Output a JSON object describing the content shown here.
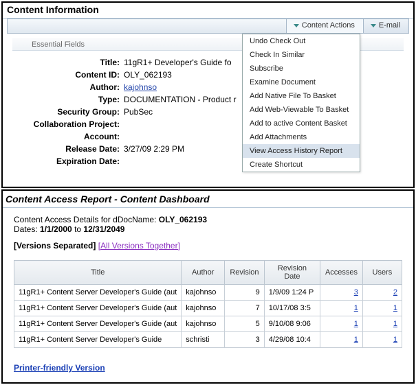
{
  "info": {
    "panel_title": "Content Information",
    "menus": {
      "content_actions": "Content Actions",
      "email": "E-mail"
    },
    "dropdown": [
      "Undo Check Out",
      "Check In Similar",
      "Subscribe",
      "Examine Document",
      "Add Native File To Basket",
      "Add Web-Viewable To Basket",
      "Add to active Content Basket",
      "Add Attachments",
      "View Access History Report",
      "Create Shortcut"
    ],
    "dropdown_highlight_index": 8,
    "fieldset": "Essential Fields",
    "labels": {
      "title": "Title:",
      "content_id": "Content ID:",
      "author": "Author:",
      "type": "Type:",
      "security_group": "Security Group:",
      "collab": "Collaboration Project:",
      "account": "Account:",
      "release_date": "Release Date:",
      "expiration_date": "Expiration Date:"
    },
    "values": {
      "title": "11gR1+ Developer's Guide fo",
      "content_id": "OLY_062193",
      "author": "kajohnso",
      "type": "DOCUMENTATION - Product r",
      "security_group": "PubSec",
      "collab": "",
      "account": "",
      "release_date": "3/27/09 2:29 PM",
      "expiration_date": ""
    }
  },
  "report": {
    "panel_title": "Content Access Report - Content Dashboard",
    "meta_prefix": "Content Access Details for dDocName: ",
    "docname": "OLY_062193",
    "dates_label": "Dates: ",
    "date_from": "1/1/2000",
    "dates_to_word": " to ",
    "date_to": "12/31/2049",
    "versions_sep": "[Versions Separated]",
    "versions_together": "[All Versions Together]",
    "columns": {
      "title": "Title",
      "author": "Author",
      "revision": "Revision",
      "rev_date": "Revision Date",
      "accesses": "Accesses",
      "users": "Users"
    },
    "rows": [
      {
        "title": "11gR1+ Content Server Developer's Guide (aut",
        "author": "kajohnso",
        "revision": "9",
        "rev_date": "1/9/09 1:24 P",
        "accesses": "3",
        "users": "2"
      },
      {
        "title": "11gR1+ Content Server Developer's Guide (aut",
        "author": "kajohnso",
        "revision": "7",
        "rev_date": "10/17/08 3:5",
        "accesses": "1",
        "users": "1"
      },
      {
        "title": "11gR1+ Content Server Developer's Guide (aut",
        "author": "kajohnso",
        "revision": "5",
        "rev_date": "9/10/08 9:06",
        "accesses": "1",
        "users": "1"
      },
      {
        "title": "11gR1+ Content Server Developer's Guide",
        "author": "schristi",
        "revision": "3",
        "rev_date": "4/29/08 10:4",
        "accesses": "1",
        "users": "1"
      }
    ],
    "printer": "Printer-friendly Version"
  }
}
